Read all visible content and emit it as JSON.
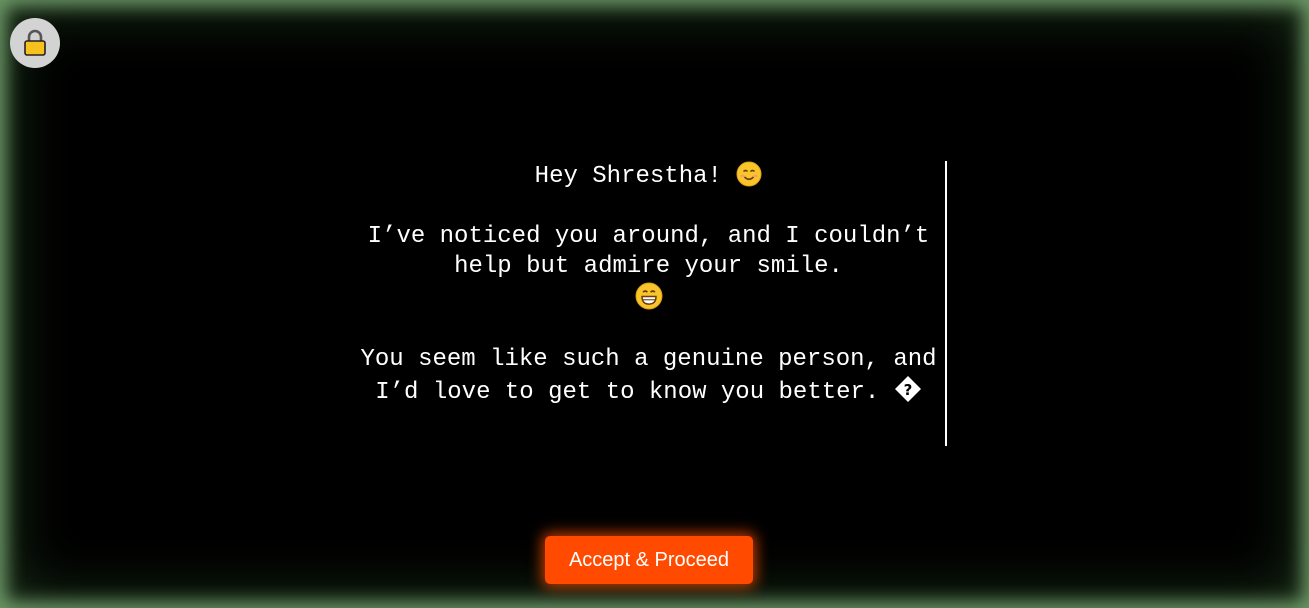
{
  "lock": {
    "icon": "lock-icon"
  },
  "message": {
    "greeting": "Hey Shrestha!",
    "greeting_emoji": "smiling-face-emoji",
    "para1": "I’ve noticed you around, and I couldn’t help but admire your smile.",
    "para1_emoji": "grinning-face-emoji",
    "para2": "You seem like such a genuine person, and I’d love to get to know you better.",
    "para2_glyph": "�"
  },
  "accept_button": {
    "label": "Accept & Proceed"
  },
  "colors": {
    "background": "#000000",
    "text": "#ffffff",
    "accent": "#ff4a00",
    "frame_glow": "#6f9a6a",
    "lock_bg": "#d3d3d3"
  }
}
